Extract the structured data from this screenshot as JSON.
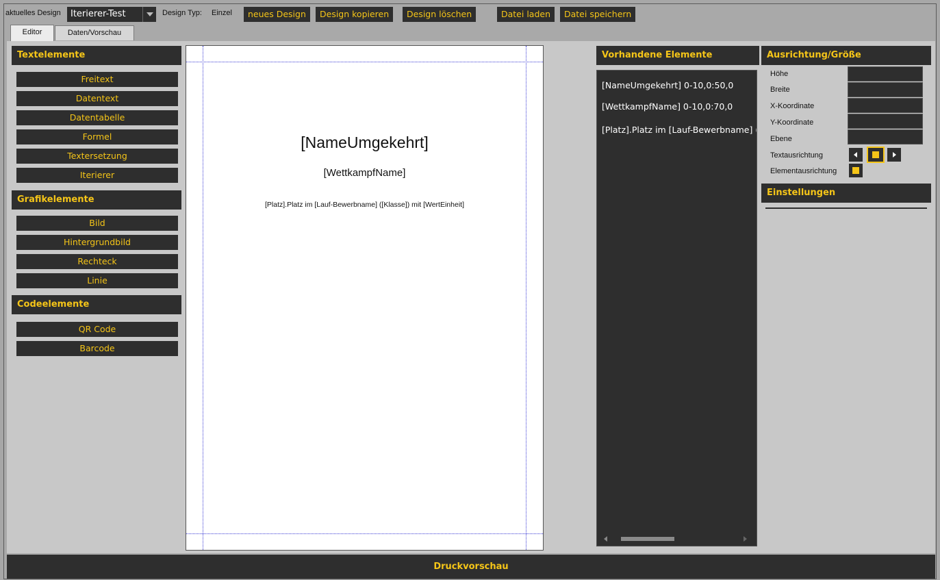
{
  "toolbar": {
    "current_design_label": "aktuelles Design",
    "current_design_value": "Iterierer-Test",
    "design_type_label": "Design Typ:",
    "design_type_value": "Einzel",
    "new_design": "neues Design",
    "copy_design": "Design kopieren",
    "delete_design": "Design löschen",
    "load_file": "Datei laden",
    "save_file": "Datei speichern"
  },
  "tabs": [
    {
      "label": "Editor",
      "active": true
    },
    {
      "label": "Daten/Vorschau",
      "active": false
    }
  ],
  "left_panel": {
    "text_elements": {
      "title": "Textelemente",
      "items": [
        "Freitext",
        "Datentext",
        "Datentabelle",
        "Formel",
        "Textersetzung",
        "Iterierer"
      ]
    },
    "graphic_elements": {
      "title": "Grafikelemente",
      "items": [
        "Bild",
        "Hintergrundbild",
        "Rechteck",
        "Linie"
      ]
    },
    "code_elements": {
      "title": "Codeelemente",
      "items": [
        "QR Code",
        "Barcode"
      ]
    }
  },
  "canvas": {
    "line1": "[NameUmgekehrt]",
    "line2": "[WettkampfName]",
    "line3": "[Platz].Platz im [Lauf-Bewerbname] ([Klasse]) mit [WertEinheit]"
  },
  "elements_panel": {
    "title": "Vorhandene Elemente",
    "items": [
      "[NameUmgekehrt] 0-10,0:50,0",
      "[WettkampfName] 0-10,0:70,0",
      "[Platz].Platz im [Lauf-Bewerbname] ([Klasse]) mit [WertEinheit]"
    ]
  },
  "properties": {
    "title": "Ausrichtung/Größe",
    "height_label": "Höhe",
    "width_label": "Breite",
    "x_label": "X-Koordinate",
    "y_label": "Y-Koordinate",
    "layer_label": "Ebene",
    "text_align_label": "Textausrichtung",
    "element_align_label": "Elementausrichtung"
  },
  "settings": {
    "title": "Einstellungen"
  },
  "footer": {
    "print_preview": "Druckvorschau"
  },
  "colors": {
    "accent": "#f5c518",
    "panel": "#2e2e2e"
  }
}
